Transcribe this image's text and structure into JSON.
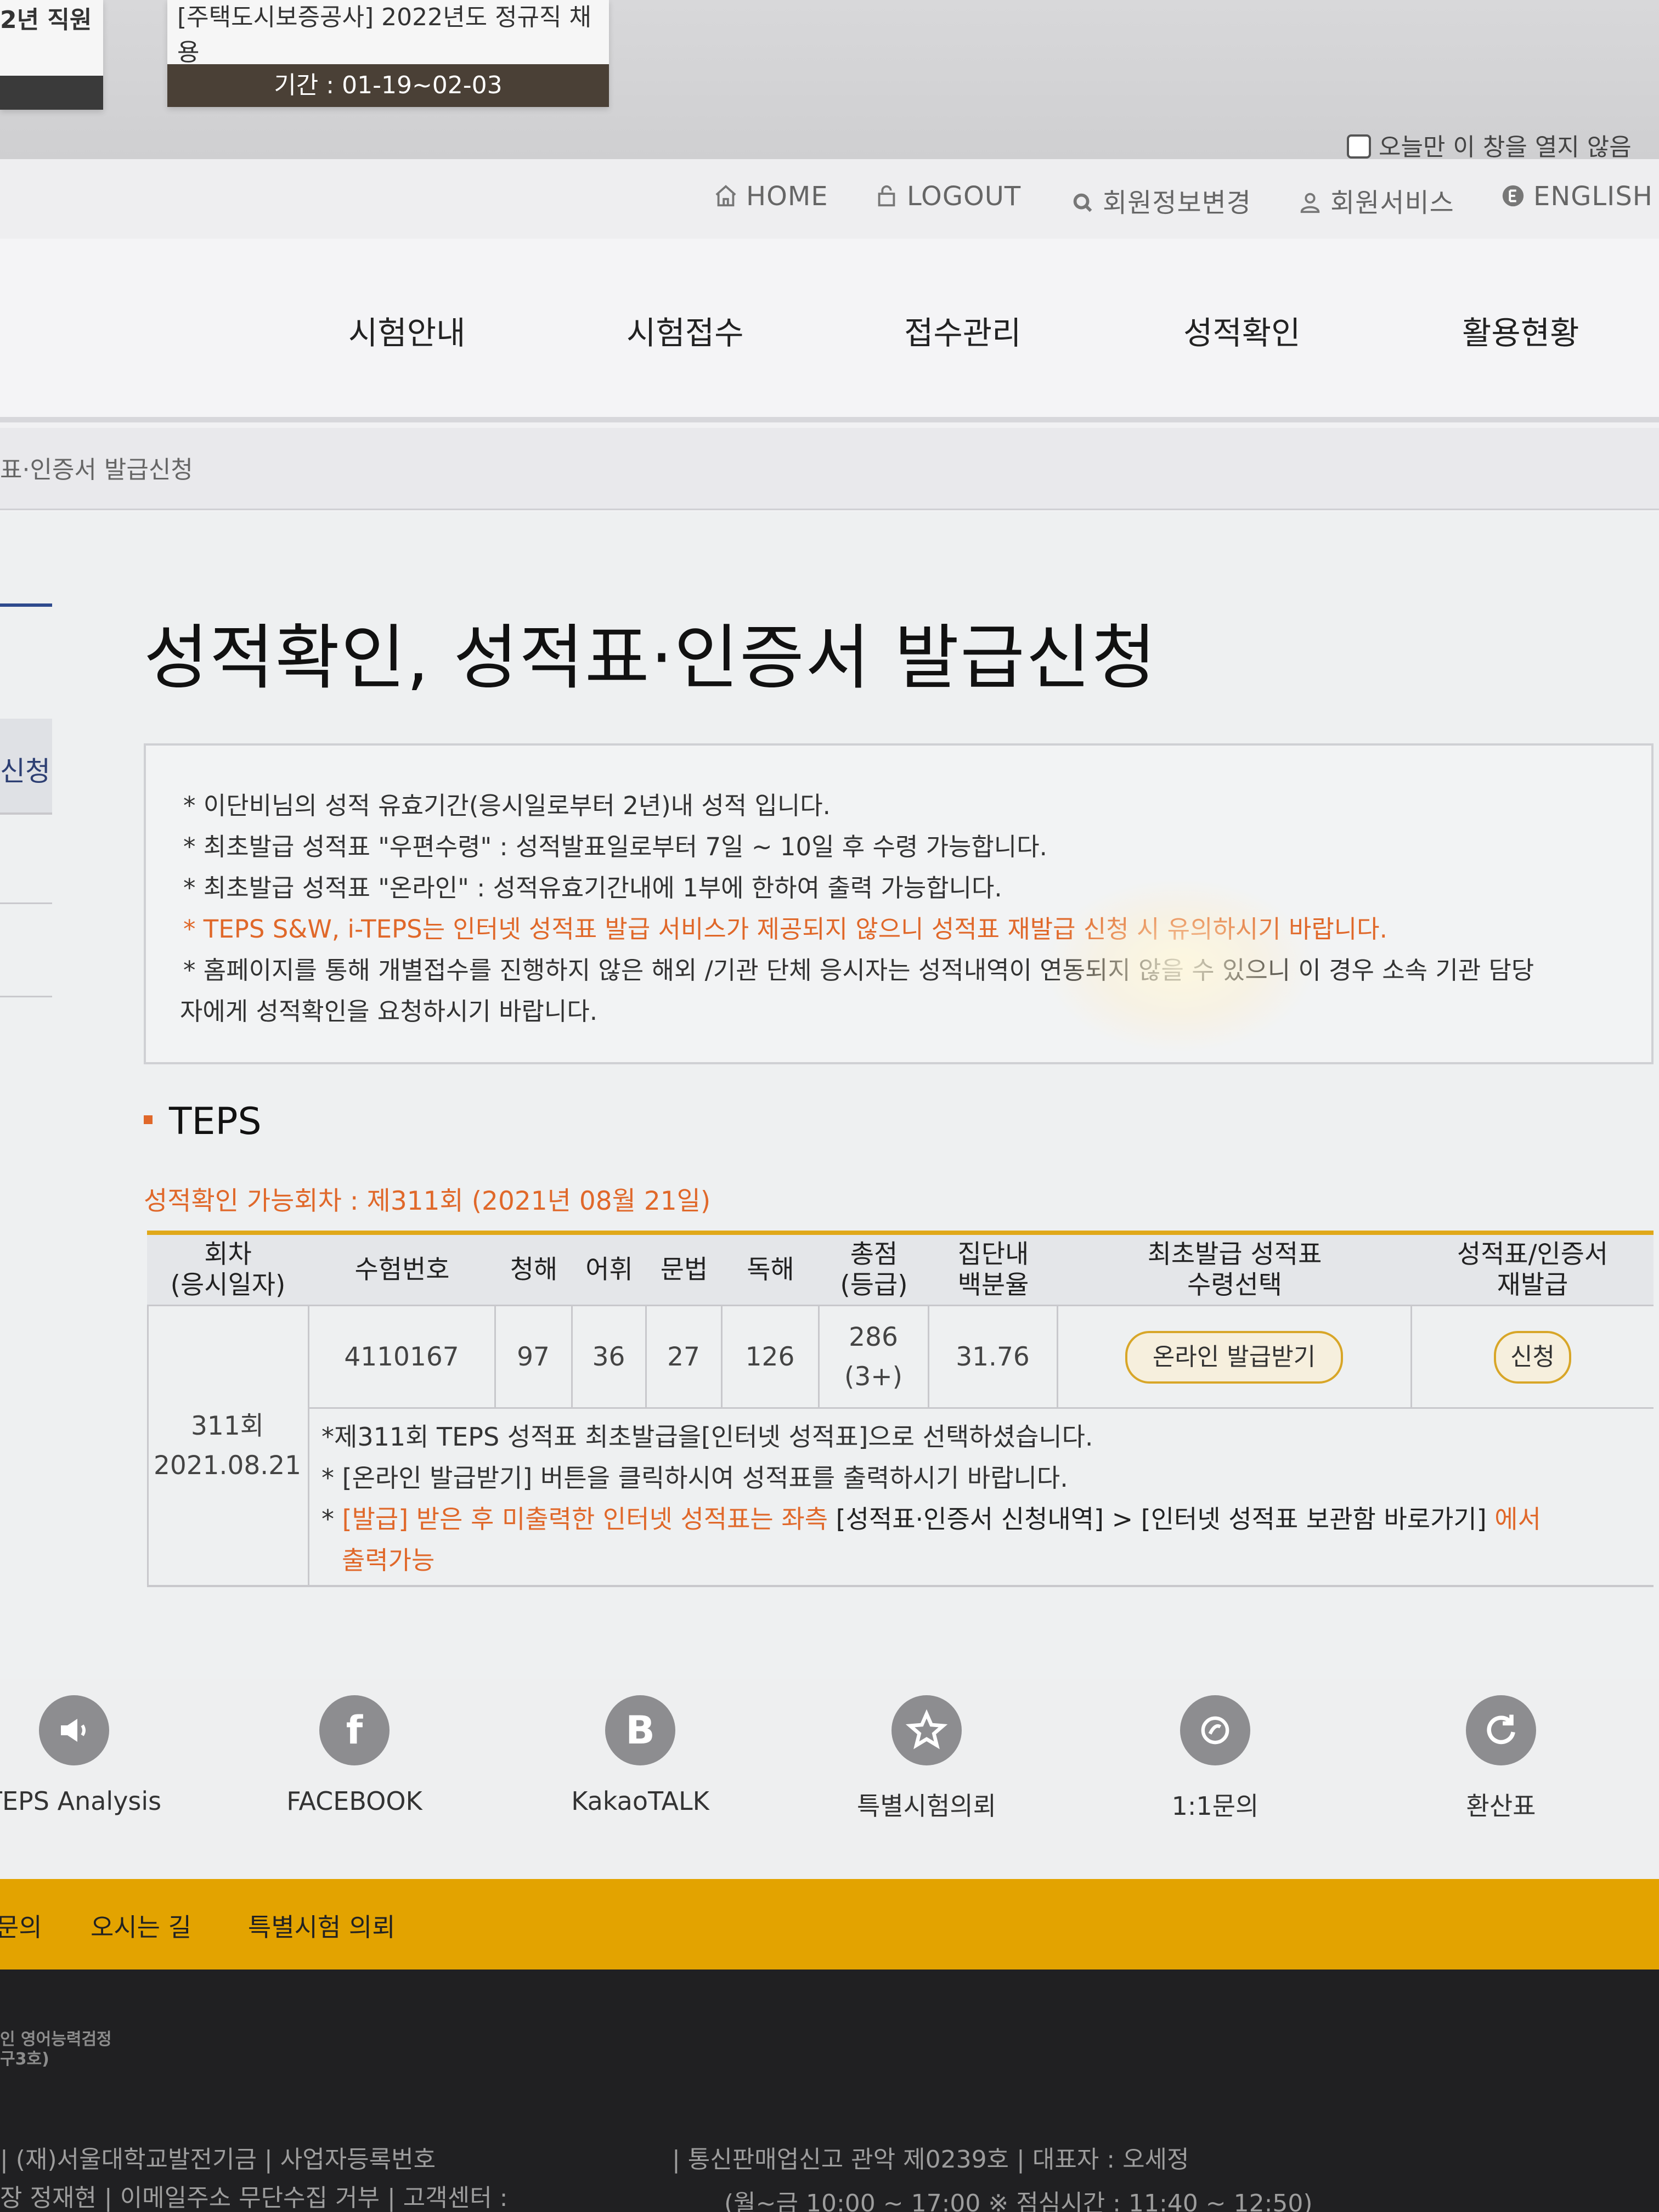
{
  "popup": {
    "left_card_title": "2년 직원",
    "right_card_title": "[주택도시보증공사] 2022년도 정규직 채용",
    "right_card_period": "기간 : 01-19~02-03",
    "no_open_today": "오늘만 이 창을 열지 않음"
  },
  "util_nav": {
    "home": "HOME",
    "logout": "LOGOUT",
    "edit_member": "회원정보변경",
    "member_service": "회원서비스",
    "english": "ENGLISH"
  },
  "main_nav": [
    "시험안내",
    "시험접수",
    "접수관리",
    "성적확인",
    "활용현황"
  ],
  "breadcrumb": "표·인증서 발급신청",
  "sidebar": {
    "active_item": "신청"
  },
  "page_title": "성적확인, 성적표·인증서 발급신청",
  "notices": [
    "* 이단비님의 성적 유효기간(응시일로부터 2년)내 성적 입니다.",
    "* 최초발급 성적표 \"우편수령\" : 성적발표일로부터 7일 ~ 10일 후 수령 가능합니다.",
    "* 최초발급 성적표 \"온라인\" : 성적유효기간내에 1부에 한하여 출력 가능합니다.",
    "* TEPS S&W, i-TEPS는 인터넷 성적표 발급 서비스가 제공되지 않으니 성적표 재발급 신청 시 유의하시기 바랍니다.",
    "* 홈페이지를 통해 개별접수를 진행하지 않은 해외 /기관 단체 응시자는 성적내역이 연동되지 않을 수 있으니 이 경우 소속 기관 담당",
    "자에게 성적확인을 요청하시기 바랍니다."
  ],
  "section_title": "TEPS",
  "available_round": "성적확인 가능회차 : 제311회 (2021년 08월 21일)",
  "table": {
    "headers": {
      "round": "회차\n(응시일자)",
      "exam_no": "수험번호",
      "listening": "청해",
      "vocab": "어휘",
      "grammar": "문법",
      "reading": "독해",
      "total": "총점\n(등급)",
      "percentile": "집단내\n백분율",
      "first_issue": "최초발급 성적표\n수령선택",
      "reissue": "성적표/인증서\n재발급"
    },
    "row": {
      "round": "311회\n2021.08.21",
      "exam_no": "4110167",
      "listening": "97",
      "vocab": "36",
      "grammar": "27",
      "reading": "126",
      "total": "286\n(3+)",
      "percentile": "31.76",
      "first_issue_button": "온라인 발급받기",
      "reissue_button": "신청"
    },
    "notes": {
      "line1": "*제311회 TEPS 성적표 최초발급을[인터넷 성적표]으로 선택하셨습니다.",
      "line2": "* [온라인 발급받기] 버튼을 클릭하시여 성적표를 출력하시기 바랍니다.",
      "line3_prefix": "* ",
      "line3_orange1": "[발급] 받은 후 미출력한 인터넷 성적표는 좌측 ",
      "line3_black": "[성적표·인증서 신청내역] > [인터넷 성적표 보관함 바로가기]",
      "line3_orange2": " 에서",
      "line4": "출력가능"
    }
  },
  "quick_links": [
    {
      "label": "TEPS Analysis",
      "icon": "megaphone-icon"
    },
    {
      "label": "FACEBOOK",
      "icon": "facebook-icon"
    },
    {
      "label": "KakaoTALK",
      "icon": "kakaotalk-icon"
    },
    {
      "label": "특별시험의뢰",
      "icon": "star-icon"
    },
    {
      "label": "1:1문의",
      "icon": "chat-icon"
    },
    {
      "label": "환산표",
      "icon": "refresh-icon"
    }
  ],
  "footer_bar": [
    "문의",
    "오시는 길",
    "특별시험 의뢰"
  ],
  "footer": {
    "logo_line1": "인 영어능력검정",
    "logo_line2": "구3호)",
    "line1_left": "| (재)서울대학교발전기금  |  사업자등록번호",
    "line1_right": "|  통신판매업신고 관악 제0239호  |  대표자 : 오세정",
    "line2_left": "장 정재현  |  이메일주소 무단수집 거부  |  고객센터 :",
    "line2_right": "(월~금 10:00 ~ 17:00 ※ 점심시간 : 11:40 ~ 12:50)"
  },
  "colors": {
    "accent_orange": "#e0682a",
    "accent_gold": "#e3a300",
    "nav_blue": "#2e4a8e"
  }
}
